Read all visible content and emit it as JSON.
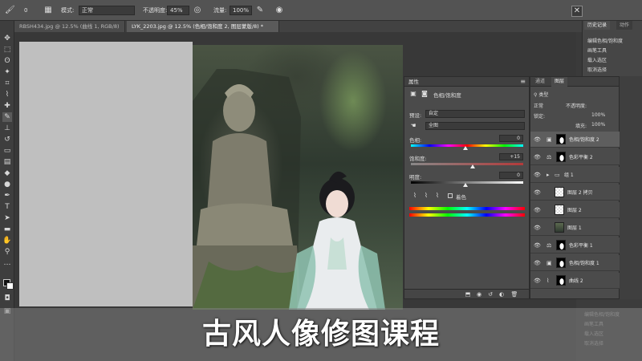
{
  "options_bar": {
    "size_value": "0",
    "mode_label": "模式:",
    "mode_value": "正常",
    "opacity_label": "不透明度:",
    "opacity_value": "45%",
    "flow_label": "流量:",
    "flow_value": "100%"
  },
  "doc_tabs": [
    {
      "label": "RBSH434.jpg @ 12.5% (曲线 1, RGB/8)",
      "active": false
    },
    {
      "label": "LYK_2203.jpg @ 12.5% (色相/饱和度 2, 图层蒙版/8) *",
      "active": true
    }
  ],
  "history_panel": {
    "tabs": [
      "历史记录",
      "动作"
    ],
    "items": [
      "编辑色相/饱和度",
      "画笔工具",
      "载入选区",
      "取消选择"
    ]
  },
  "properties_panel": {
    "title": "属性",
    "adjustment_name": "色相/饱和度",
    "preset_label": "预设:",
    "preset_value": "自定",
    "channel_value": "全图",
    "hue_label": "色相:",
    "hue_value": "0",
    "saturation_label": "饱和度:",
    "saturation_value": "+15",
    "lightness_label": "明度:",
    "lightness_value": "0",
    "colorize_label": "着色"
  },
  "layers_panel": {
    "tabs": [
      "通道",
      "图层"
    ],
    "kind_filter": "类型",
    "blend_mode": "正常",
    "opacity_label": "不透明度:",
    "opacity_value": "100%",
    "lock_label": "锁定:",
    "fill_label": "填充:",
    "fill_value": "100%",
    "layers": [
      {
        "name": "色相/饱和度 2",
        "selected": true,
        "type": "hsl"
      },
      {
        "name": "色彩平衡 2",
        "selected": false,
        "type": "balance"
      },
      {
        "name": "组 1",
        "selected": false,
        "type": "group"
      },
      {
        "name": "图层 2 拷贝",
        "selected": false,
        "type": "pixel"
      },
      {
        "name": "图层 2",
        "selected": false,
        "type": "pixel"
      },
      {
        "name": "图层 1",
        "selected": false,
        "type": "photo"
      },
      {
        "name": "色彩平衡 1",
        "selected": false,
        "type": "balance"
      },
      {
        "name": "色相/饱和度 1",
        "selected": false,
        "type": "hsl"
      },
      {
        "name": "曲线 2",
        "selected": false,
        "type": "curves"
      }
    ]
  },
  "caption": "古风人像修图课程",
  "colors": {
    "panel": "#4b4b4b",
    "options_bar": "#535353",
    "canvas_gray": "#bfbfbf",
    "caption_text": "#ffffff"
  }
}
